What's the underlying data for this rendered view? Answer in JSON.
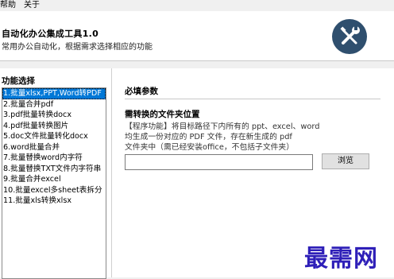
{
  "menubar": {
    "items": [
      "帮助",
      "关于"
    ]
  },
  "header": {
    "title": "自动化办公集成工具1.0",
    "subtitle": "常用办公自动化，根据需求选择相应的功能",
    "logo_icon": "wrench-screwdriver-icon"
  },
  "left_panel": {
    "title": "功能选择",
    "selected_index": 0,
    "items": [
      "1.批量xlsx,PPT,Word转PDF",
      "2.批量合并pdf",
      "3.pdf批量转换docx",
      "4.pdf批量转换图片",
      "5.doc文件批量转化docx",
      "6.word批量合并",
      "7.批量替换word内字符",
      "8.批量替换TXT文件内字符串",
      "9.批量合并excel",
      "10.批量excel多sheet表拆分",
      "11.批量xls转换xlsx"
    ]
  },
  "right_panel": {
    "section_title": "必填参数",
    "field_label": "需转换的文件夹位置",
    "description_lines": [
      "【程序功能】将目标路径下内所有的 ppt、excel、word",
      "均生成一份对应的 PDF 文件，存在新生成的 pdf",
      "文件夹中（需已经安装office，不包括子文件夹）"
    ],
    "folder_value": "",
    "browse_label": "浏览"
  },
  "watermark": "最需网",
  "colors": {
    "selection": "#0078d7",
    "watermark": "#2e1fb8",
    "logo_bg": "#2f4f6e"
  }
}
